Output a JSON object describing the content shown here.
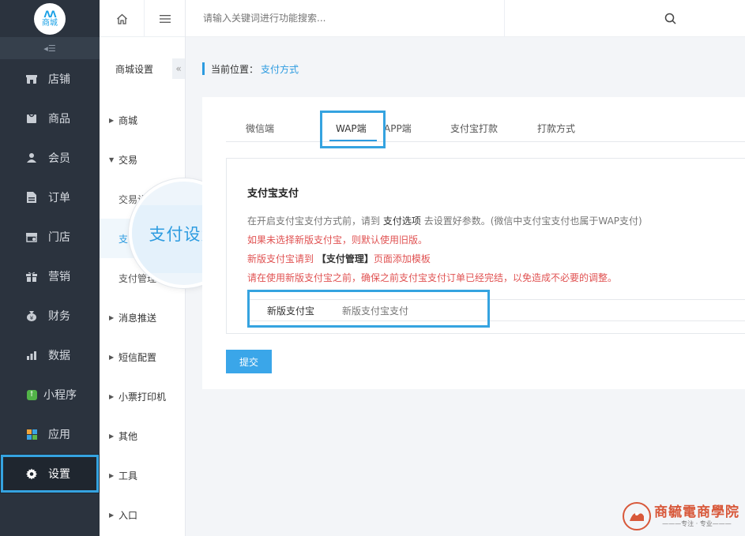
{
  "sidebar": {
    "logo_text": "商城",
    "items": [
      {
        "label": "店铺",
        "icon": "store-icon"
      },
      {
        "label": "商品",
        "icon": "goods-icon"
      },
      {
        "label": "会员",
        "icon": "user-icon"
      },
      {
        "label": "订单",
        "icon": "order-icon"
      },
      {
        "label": "门店",
        "icon": "shop-icon"
      },
      {
        "label": "营销",
        "icon": "gift-icon"
      },
      {
        "label": "财务",
        "icon": "money-bag-icon"
      },
      {
        "label": "数据",
        "icon": "chart-icon"
      },
      {
        "label": "小程序",
        "icon": "mini-program-icon"
      },
      {
        "label": "应用",
        "icon": "apps-icon"
      },
      {
        "label": "设置",
        "icon": "gear-icon",
        "active": true
      }
    ]
  },
  "sub_sidebar": {
    "title": "商城设置",
    "sections": [
      {
        "label": "商城"
      },
      {
        "label": "交易",
        "expanded": true,
        "children": [
          "交易设置",
          "支付设置",
          "支付管理"
        ]
      },
      {
        "label": "消息推送"
      },
      {
        "label": "短信配置"
      },
      {
        "label": "小票打印机"
      },
      {
        "label": "其他"
      },
      {
        "label": "工具"
      },
      {
        "label": "入口"
      }
    ],
    "child_visible": [
      "交易设",
      "支",
      "支付管理"
    ]
  },
  "magnifier": {
    "label": "支付设置"
  },
  "topbar": {
    "search_placeholder": "请输入关键词进行功能搜索..."
  },
  "breadcrumb": {
    "prefix": "当前位置：",
    "current": "支付方式"
  },
  "tabs": [
    {
      "label": "微信端"
    },
    {
      "label": "WAP端",
      "active": true
    },
    {
      "label": "APP端"
    },
    {
      "label": "支付宝打款"
    },
    {
      "label": "打款方式"
    }
  ],
  "alipay": {
    "title": "支付宝支付",
    "note1_a": "在开启支付宝支付方式前，请到",
    "note1_b": "支付选项",
    "note1_c": "去设置好参数。(微信中支付宝支付也属于WAP支付)",
    "note2": "如果未选择新版支付宝，则默认使用旧版。",
    "note3_a": "新版支付宝请到",
    "note3_b": "【支付管理】",
    "note3_c": "页面添加模板",
    "note4": "请在使用新版支付宝之前，确保之前支付宝支付订单已经完结，以免造成不必要的调整。",
    "field_label": "新版支付宝",
    "field_value": "新版支付宝支付"
  },
  "submit_label": "提交",
  "watermark": {
    "main": "商毓電商學院",
    "sub": "———专注 · 专业———"
  },
  "colors": {
    "accent": "#2c9be0",
    "sidebar_bg": "#2b333e",
    "highlight": "#35a3e0",
    "warning": "#e05252"
  }
}
